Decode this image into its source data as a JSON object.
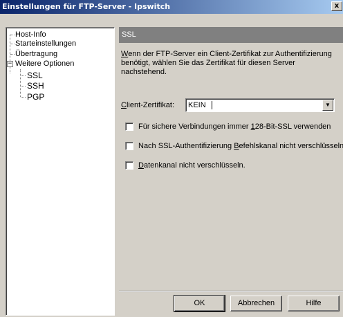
{
  "window": {
    "title": "Einstellungen für FTP-Server - Ipswitch",
    "close_glyph": "x"
  },
  "tree": {
    "items": [
      {
        "label": "Host-Info"
      },
      {
        "label": "Starteinstellungen"
      },
      {
        "label": "Übertragung"
      },
      {
        "label": "Weitere Optionen",
        "expander": "−"
      },
      {
        "label": "SSL"
      },
      {
        "label": "SSH"
      },
      {
        "label": "PGP"
      }
    ]
  },
  "panel": {
    "header": "SSL",
    "description": {
      "pre": "",
      "mnemonic": "W",
      "post": "enn der FTP-Server ein Client-Zertifikat zur Authentifizierung benötigt, wählen Sie das Zertifikat für diesen Server nachstehend."
    },
    "certificate": {
      "label_mnemonic": "C",
      "label_rest": "lient-Zertifikat:",
      "value": "KEIN",
      "dropdown_glyph": "▼"
    },
    "checkboxes": [
      {
        "pre": "Für sichere Verbindungen immer ",
        "mnemonic": "1",
        "post": "28-Bit-SSL verwenden",
        "checked": false
      },
      {
        "pre": "Nach SSL-Authentifizierung ",
        "mnemonic": "B",
        "post": "efehlskanal nicht verschlüsseln.",
        "checked": false
      },
      {
        "pre": "",
        "mnemonic": "D",
        "post": "atenkanal nicht verschlüsseln.",
        "checked": false
      }
    ]
  },
  "buttons": {
    "ok": "OK",
    "cancel": "Abbrechen",
    "help": "Hilfe"
  }
}
